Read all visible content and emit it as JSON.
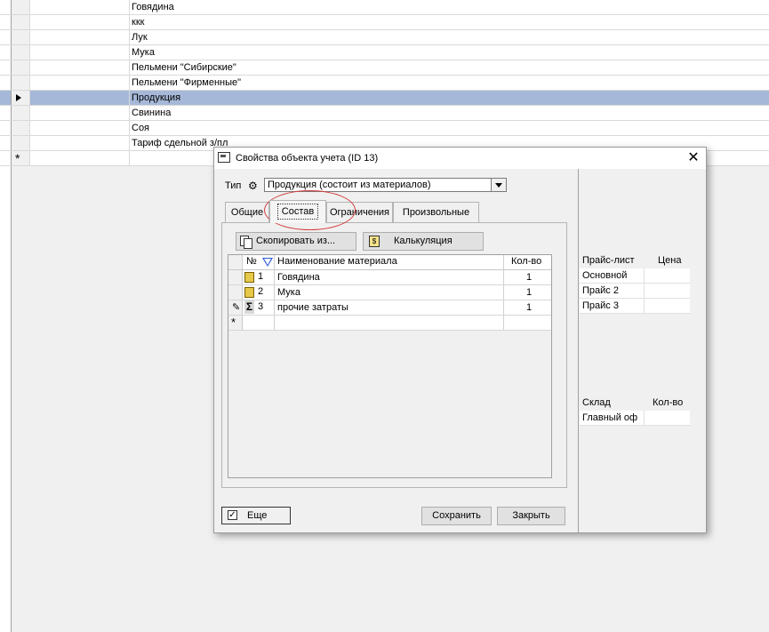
{
  "background_list": {
    "rows": [
      {
        "text": "Говядина",
        "selected": false
      },
      {
        "text": "ккк",
        "selected": false
      },
      {
        "text": "Лук",
        "selected": false
      },
      {
        "text": "Мука",
        "selected": false
      },
      {
        "text": "Пельмени \"Сибирские\"",
        "selected": false
      },
      {
        "text": "Пельмени \"Фирменные\"",
        "selected": false
      },
      {
        "text": "Продукция",
        "selected": true
      },
      {
        "text": "Свинина",
        "selected": false
      },
      {
        "text": "Соя",
        "selected": false
      },
      {
        "text": "Тариф сдельной з/пл",
        "selected": false
      }
    ],
    "new_row_marker": "*"
  },
  "dialog": {
    "title": "Свойства объекта учета  (ID 13)",
    "close_glyph": "✕",
    "type_label": "Тип",
    "type_value": "Продукция (состоит из материалов)",
    "tabs": [
      {
        "label": "Общие",
        "active": false
      },
      {
        "label": "Состав",
        "active": true
      },
      {
        "label": "Ограничения",
        "active": false
      },
      {
        "label": "Произвольные",
        "active": false
      }
    ],
    "copy_button": "Скопировать из...",
    "calc_button": "Калькуляция",
    "materials_grid": {
      "headers": {
        "num": "№",
        "name": "Наименование материала",
        "qty": "Кол-во"
      },
      "rows": [
        {
          "num": "1",
          "name": "Говядина",
          "qty": "1",
          "icon": "material-icon"
        },
        {
          "num": "2",
          "name": "Мука",
          "qty": "1",
          "icon": "material-icon"
        },
        {
          "num": "3",
          "name": "прочие затраты",
          "qty": "1",
          "icon": "sum-icon"
        }
      ],
      "new_row_marker": "*"
    },
    "more_checkbox_label": "Еще",
    "more_checked": true,
    "save_button": "Сохранить",
    "close_button": "Закрыть",
    "price_table": {
      "headers": {
        "col1": "Прайс-лист",
        "col2": "Цена"
      },
      "rows": [
        "Основной",
        "Прайс 2",
        "Прайс 3"
      ]
    },
    "stock_table": {
      "headers": {
        "col1": "Склад",
        "col2": "Кол-во"
      },
      "rows": [
        "Главный оф"
      ]
    }
  },
  "colors": {
    "selection": "#a6b8d8",
    "annotation": "#d43b3b",
    "filter_icon": "#2a5bd7"
  }
}
